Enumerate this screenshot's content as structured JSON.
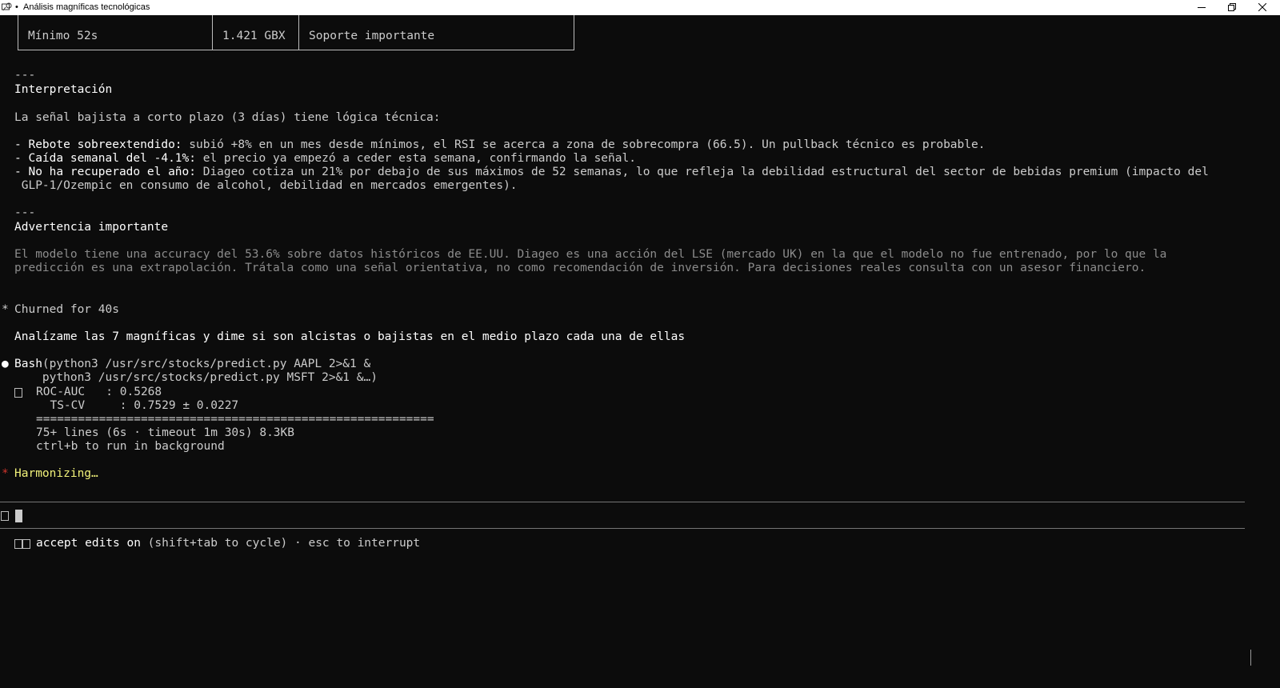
{
  "window": {
    "title": "Análisis magníficas tecnológicas",
    "title_dot": "•",
    "controls": [
      "minimize-icon",
      "restore-icon",
      "close-icon"
    ]
  },
  "table_row": {
    "col1": "Mínimo 52s",
    "col2": "1.421 GBX",
    "col3": "Soporte importante"
  },
  "sections": {
    "divider": "---",
    "interpretation": {
      "heading": "Interpretación",
      "intro": "La señal bajista a corto plazo (3 días) tiene lógica técnica:",
      "bullets": [
        {
          "dash": "- ",
          "bold": "Rebote sobreextendido:",
          "text": " subió +8% en un mes desde mínimos, el RSI se acerca a zona de sobrecompra (66.5). Un pullback técnico es probable."
        },
        {
          "dash": "- ",
          "bold": "Caída semanal del -4.1%:",
          "text": " el precio ya empezó a ceder esta semana, confirmando la señal."
        },
        {
          "dash": "- ",
          "bold": "No ha recuperado el año:",
          "text": " Diageo cotiza un 21% por debajo de sus máximos de 52 semanas, lo que refleja la debilidad estructural del sector de bebidas premium (impacto del",
          "continuation": " GLP-1/Ozempic en consumo de alcohol, debilidad en mercados emergentes)."
        }
      ]
    },
    "warning": {
      "heading": "Advertencia importante",
      "line1": "El modelo tiene una accuracy del 53.6% sobre datos históricos de EE.UU. Diageo es una acción del LSE (mercado UK) en la que el modelo no fue entrenado, por lo que la",
      "line2": "predicción es una extrapolación. Trátala como una señal orientativa, no como recomendación de inversión. Para decisiones reales consulta con un asesor financiero."
    }
  },
  "churned": {
    "marker": "*",
    "text": "Churned for 40s"
  },
  "user_prompt": "Analízame las 7 magníficas y dime si son alcistas o bajistas en el medio plazo cada una de ellas",
  "tool_call": {
    "marker": "●",
    "tool": "Bash",
    "args_line1": "(python3 /usr/src/stocks/predict.py AAPL 2>&1 &",
    "args_line2": "    python3 /usr/src/stocks/predict.py MSFT 2>&1 &…)",
    "output": [
      "ROC-AUC   : 0.5268",
      "  TS-CV     : 0.7529 ± 0.0227",
      "=========================================================",
      "75+ lines (6s · timeout 1m 30s) 8.3KB",
      "ctrl+b to run in background"
    ]
  },
  "status": {
    "marker": "*",
    "text": "Harmonizing…"
  },
  "footer": {
    "accept_bold": "accept edits on",
    "accept_rest": " (shift+tab to cycle) · esc to interrupt"
  }
}
